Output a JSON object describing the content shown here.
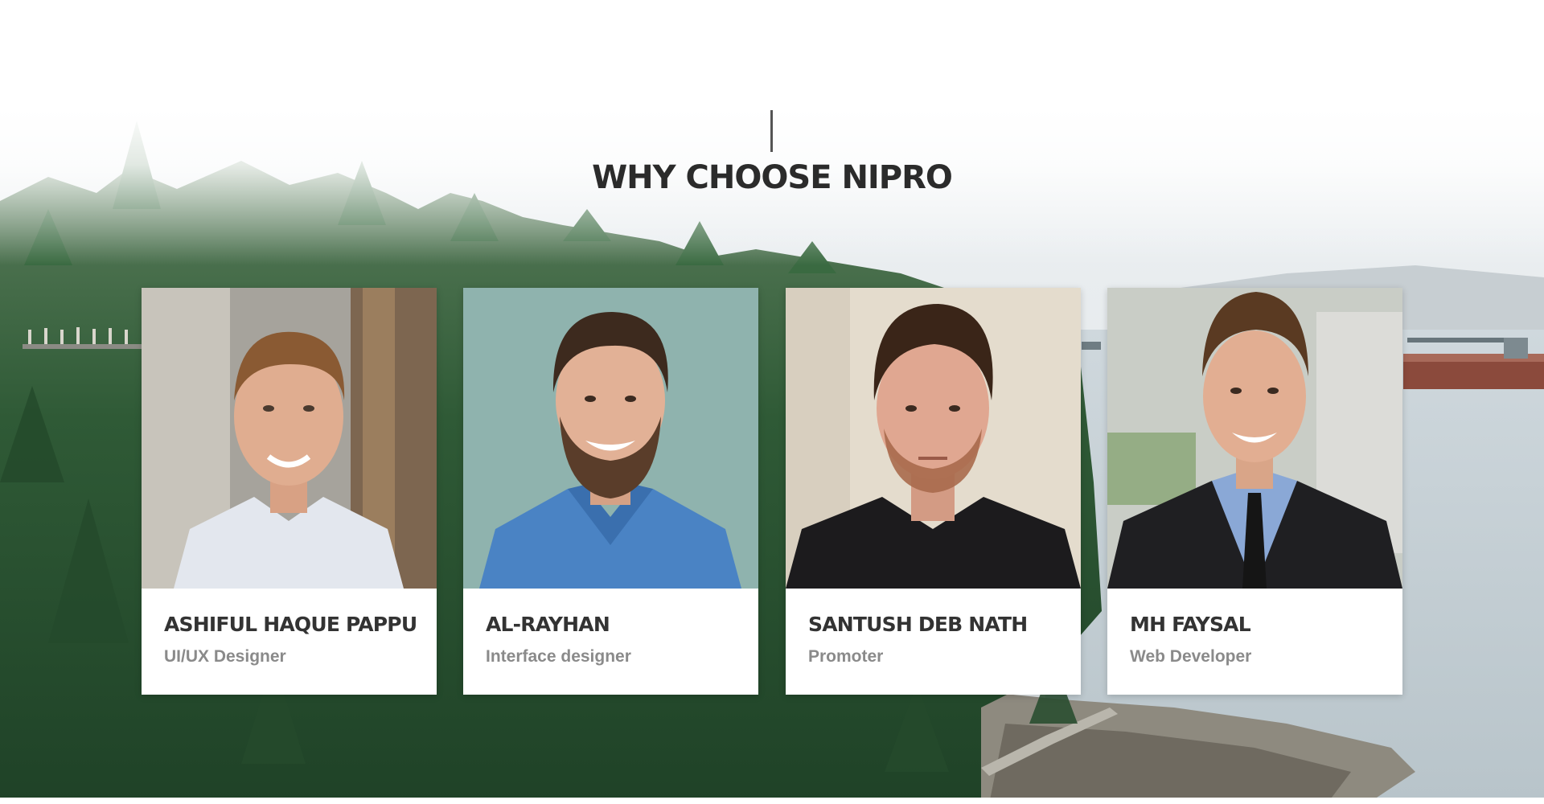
{
  "section": {
    "title": "WHY CHOOSE NIPRO"
  },
  "team": [
    {
      "name": "ASHIFUL HAQUE PAPPU",
      "role": "UI/UX Designer",
      "photo_icon": "person-photo"
    },
    {
      "name": "AL-RAYHAN",
      "role": "Interface designer",
      "photo_icon": "person-photo"
    },
    {
      "name": "SANTUSH DEB NATH",
      "role": "Promoter",
      "photo_icon": "person-photo"
    },
    {
      "name": "MH FAYSAL",
      "role": "Web Developer",
      "photo_icon": "person-photo"
    }
  ],
  "colors": {
    "title": "#2b2b2b",
    "name": "#333333",
    "role": "#8a8a8a",
    "forest": "#2f5a36",
    "water": "#c9d3d8"
  }
}
